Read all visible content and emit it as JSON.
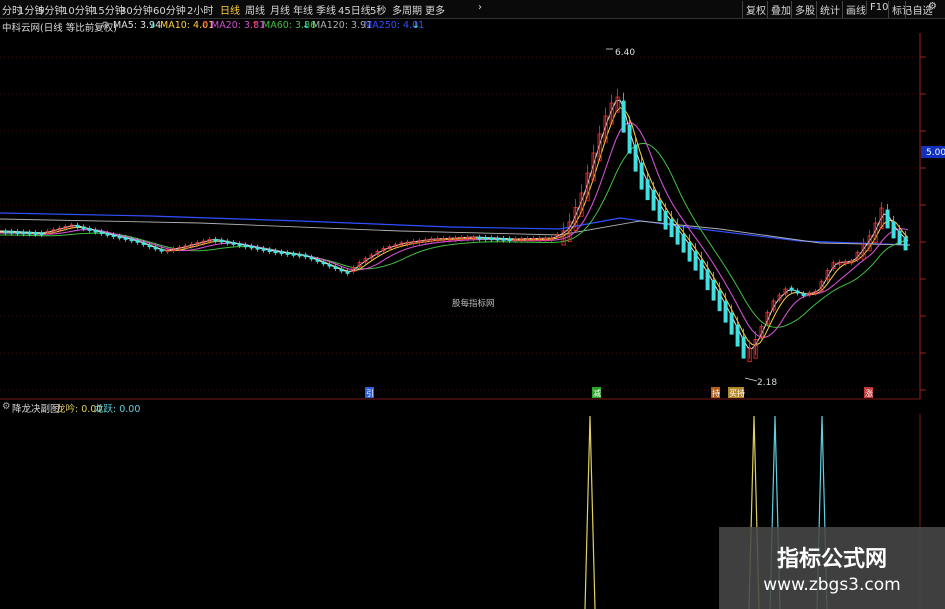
{
  "toolbar": {
    "periods": [
      {
        "label": "分时"
      },
      {
        "label": "1分钟"
      },
      {
        "label": "5分钟"
      },
      {
        "label": "10分钟"
      },
      {
        "label": "15分钟"
      },
      {
        "label": "30分钟"
      },
      {
        "label": "60分钟"
      },
      {
        "label": "2小时"
      },
      {
        "label": "日线",
        "active": true
      },
      {
        "label": "周线"
      },
      {
        "label": "月线"
      },
      {
        "label": "年线"
      },
      {
        "label": "季线"
      },
      {
        "label": "45日线"
      },
      {
        "label": "5秒"
      },
      {
        "label": "多周期"
      },
      {
        "label": "更多"
      }
    ],
    "more_arrow": "›",
    "right_buttons": [
      {
        "label": "复权"
      },
      {
        "label": "叠加"
      },
      {
        "label": "多股"
      },
      {
        "label": "统计"
      },
      {
        "label": "画线"
      },
      {
        "label": "F10"
      },
      {
        "label": "标记"
      },
      {
        "label": "-自选"
      }
    ],
    "settings_icon": "gear-icon",
    "settings_glyph": "⚙"
  },
  "legend": {
    "title": "中科云网(日线 等比前复权)",
    "ma5": {
      "label": "MA5: 3.94",
      "color": "#e0e0e0"
    },
    "ma10": {
      "label": "MA10: 4.01",
      "color": "#ffd23f"
    },
    "ma20": {
      "label": "MA20: 3.81",
      "color": "#d050d0"
    },
    "ma60": {
      "label": "MA60: 3.86",
      "color": "#40c040"
    },
    "ma120": {
      "label": "MA120: 3.91",
      "color": "#b0b0b0"
    },
    "ma250": {
      "label": "MA250: 4.01",
      "color": "#3050ff"
    },
    "arrow_down": "↓",
    "arrow_up": "↑"
  },
  "main": {
    "watermark_center": "股每指标网",
    "peak_label": "6.40",
    "trough_label": "2.18",
    "right_price_tag": "5.00",
    "signal_markers": [
      {
        "label": "引",
        "color": "#3070ff"
      },
      {
        "label": "减",
        "color": "#30c030"
      },
      {
        "label": "持",
        "color": "#d07020"
      },
      {
        "label": "买持",
        "color": "#d0a030"
      },
      {
        "label": "涨",
        "color": "#e04040"
      }
    ]
  },
  "sub": {
    "title": "降龙决副图",
    "line1": {
      "label": "龙吟: 0.00",
      "color": "#e0d060"
    },
    "line2": {
      "label": "龙跃: 0.00",
      "color": "#60d0e0"
    }
  },
  "footer_watermark": {
    "title": "指标公式网",
    "url": "www.zbgs3.com"
  },
  "colors": {
    "up": "#ff3030",
    "down": "#40e0e0",
    "grid": "#7a1a1a",
    "axis": "#a02020"
  }
}
